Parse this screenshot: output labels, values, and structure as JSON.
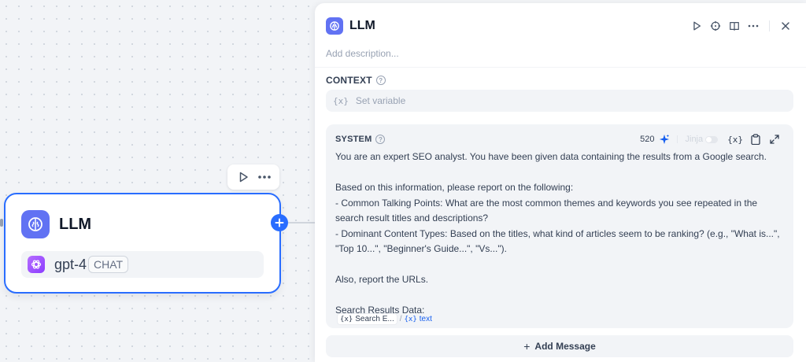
{
  "canvas": {
    "node": {
      "title": "LLM",
      "model_name": "gpt-4",
      "model_mode": "CHAT"
    },
    "icons": {
      "run": "play-icon",
      "more": "more-horizontal-icon",
      "add": "plus-icon",
      "node_logo": "brain-icon",
      "model_logo": "openai-icon"
    }
  },
  "panel": {
    "title": "LLM",
    "description_placeholder": "Add description...",
    "actions": [
      "play-icon",
      "locate-icon",
      "book-icon",
      "more-icon",
      "close-icon"
    ],
    "context": {
      "label": "CONTEXT",
      "variable_prefix": "{x}",
      "placeholder": "Set variable"
    },
    "system": {
      "label": "SYSTEM",
      "char_count": "520",
      "jinja_label": "Jinja",
      "jinja_enabled": false,
      "variable_icon_label": "{x}",
      "lines": [
        "You are an expert SEO analyst. You have been given data containing the results from a Google search.",
        "",
        "Based on this information, please report on the following:",
        "- Common Talking Points: What are the most common themes and keywords you see repeated in the search result titles and descriptions?",
        "- Dominant Content Types: Based on the titles, what kind of articles seem to be ranking? (e.g., \"What is...\", \"Top 10...\", \"Beginner's Guide...\", \"Vs...\").",
        "",
        "Also, report the URLs.",
        "",
        "Search Results Data:"
      ],
      "chip_node_prefix": "{x}",
      "chip_node": "Search E...",
      "chip_separator": "/",
      "chip_var_prefix": "{x}",
      "chip_var": "text"
    },
    "add_message_label": "Add Message",
    "add_message_icon": "+"
  },
  "colors": {
    "accent": "#296dff",
    "node_logo_bg": "#6172f3",
    "model_logo_bg": "#9b4dff",
    "canvas_bg": "#f2f4f7"
  }
}
